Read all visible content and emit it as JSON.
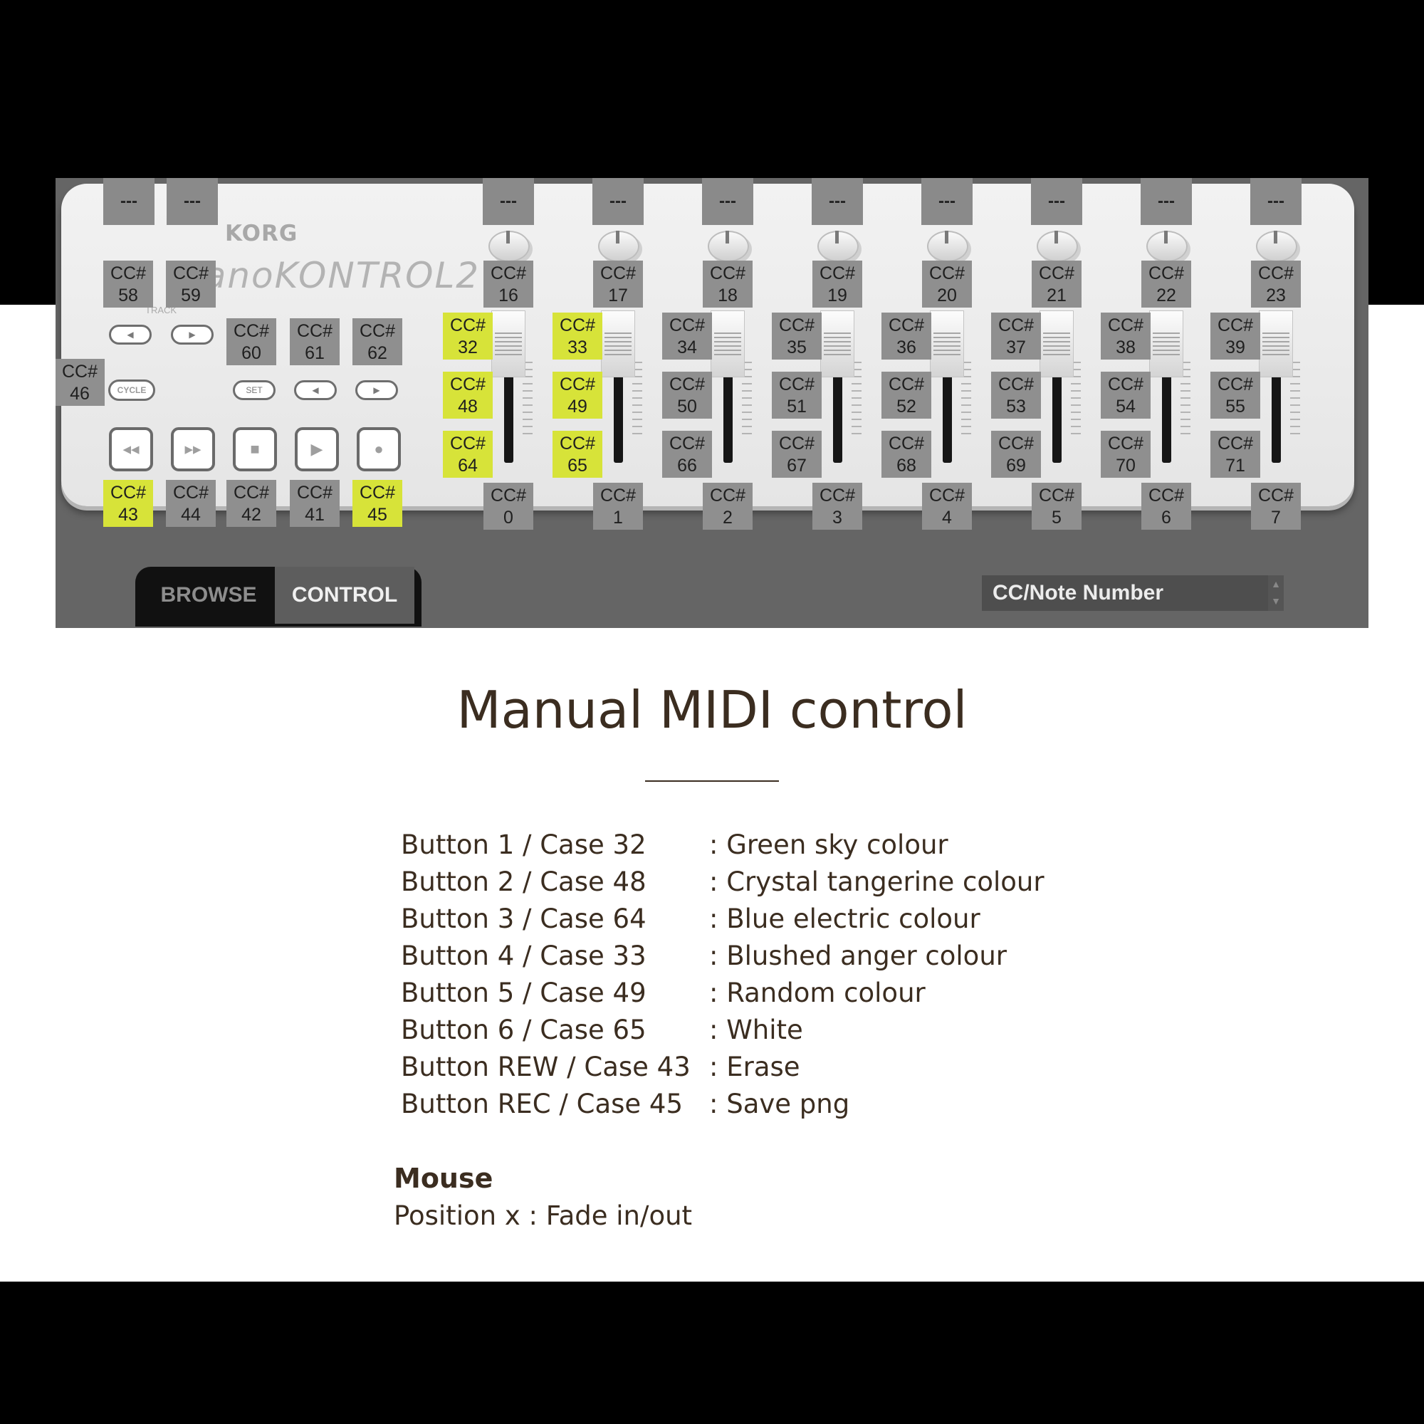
{
  "controller": {
    "brand": "KORG",
    "model": "nanoKONTROL2",
    "track_label": "TRACK",
    "cycle_label": "CYCLE",
    "set_label": "SET",
    "empty_label": "---",
    "highlight_color": "#d7e339",
    "tag_color": "#8f8f8f",
    "left_tags": [
      {
        "l1": "CC#",
        "l2": "58"
      },
      {
        "l1": "CC#",
        "l2": "59"
      },
      {
        "l1": "CC#",
        "l2": "60"
      },
      {
        "l1": "CC#",
        "l2": "61"
      },
      {
        "l1": "CC#",
        "l2": "62"
      },
      {
        "l1": "CC#",
        "l2": "46"
      },
      {
        "l1": "CC#",
        "l2": "43",
        "highlight": true
      },
      {
        "l1": "CC#",
        "l2": "44"
      },
      {
        "l1": "CC#",
        "l2": "42"
      },
      {
        "l1": "CC#",
        "l2": "41"
      },
      {
        "l1": "CC#",
        "l2": "45",
        "highlight": true
      }
    ],
    "transport_icons": [
      "rewind-icon",
      "fast-forward-icon",
      "stop-icon",
      "play-icon",
      "record-icon"
    ],
    "channels": [
      {
        "knob": "16",
        "s": "32",
        "m": "48",
        "r": "64",
        "fader": "0",
        "hl": true
      },
      {
        "knob": "17",
        "s": "33",
        "m": "49",
        "r": "65",
        "fader": "1",
        "hl": true
      },
      {
        "knob": "18",
        "s": "34",
        "m": "50",
        "r": "66",
        "fader": "2",
        "hl": false
      },
      {
        "knob": "19",
        "s": "35",
        "m": "51",
        "r": "67",
        "fader": "3",
        "hl": false
      },
      {
        "knob": "20",
        "s": "36",
        "m": "52",
        "r": "68",
        "fader": "4",
        "hl": false
      },
      {
        "knob": "21",
        "s": "37",
        "m": "53",
        "r": "69",
        "fader": "5",
        "hl": false
      },
      {
        "knob": "22",
        "s": "38",
        "m": "54",
        "r": "70",
        "fader": "6",
        "hl": false
      },
      {
        "knob": "23",
        "s": "39",
        "m": "55",
        "r": "71",
        "fader": "7",
        "hl": false
      }
    ]
  },
  "tabs": {
    "browse": "BROWSE",
    "control": "CONTROL"
  },
  "dropdown": {
    "value": "CC/Note Number"
  },
  "heading": "Manual MIDI control",
  "mappings": [
    {
      "button": "Button 1 / Case 32",
      "action": ": Green sky colour"
    },
    {
      "button": "Button 2 / Case 48",
      "action": ": Crystal tangerine colour"
    },
    {
      "button": "Button 3 / Case 64",
      "action": ": Blue electric colour"
    },
    {
      "button": "Button 4 / Case 33",
      "action": ": Blushed anger colour"
    },
    {
      "button": "Button 5 / Case 49",
      "action": ": Random colour"
    },
    {
      "button": "Button 6 / Case 65",
      "action": ": White"
    },
    {
      "button": "Button REW / Case 43",
      "action": ": Erase"
    },
    {
      "button": "Button REC / Case 45",
      "action": ": Save png"
    }
  ],
  "mouse": {
    "heading": "Mouse",
    "text": "Position x : Fade in/out"
  }
}
